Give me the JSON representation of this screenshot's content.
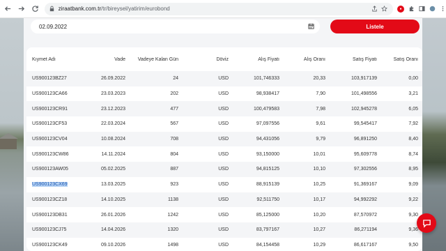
{
  "browser": {
    "url_host": "ziraatbank.com.tr",
    "url_path": "/tr/bireysel/yatirim/eurobond"
  },
  "filter": {
    "date": "02.09.2022",
    "button_label": "Listele"
  },
  "table": {
    "headers": [
      "Kıymet Adı",
      "Vade",
      "Vadeye Kalan Gün",
      "Döviz",
      "Alış Fiyatı",
      "Alış Oranı",
      "Satış Fiyatı",
      "Satış Oranı"
    ],
    "rows": [
      [
        "US900123BZ27",
        "26.09.2022",
        "24",
        "USD",
        "101,746333",
        "20,33",
        "103,917139",
        "0,00"
      ],
      [
        "US900123CA66",
        "23.03.2023",
        "202",
        "USD",
        "98,938417",
        "7,90",
        "101,498556",
        "3,21"
      ],
      [
        "US900123CR91",
        "23.12.2023",
        "477",
        "USD",
        "100,479583",
        "7,98",
        "102,945278",
        "6,05"
      ],
      [
        "US900123CF53",
        "22.03.2024",
        "567",
        "USD",
        "97,097556",
        "9,61",
        "99,545417",
        "7,92"
      ],
      [
        "US900123CV04",
        "10.08.2024",
        "708",
        "USD",
        "94,431056",
        "9,79",
        "96,891250",
        "8,40"
      ],
      [
        "US900123CW86",
        "14.11.2024",
        "804",
        "USD",
        "93,150000",
        "10,01",
        "95,609778",
        "8,74"
      ],
      [
        "US900123AW05",
        "05.02.2025",
        "887",
        "USD",
        "94,815125",
        "10,10",
        "97,302556",
        "8,95"
      ],
      [
        "US900123CX69",
        "13.03.2025",
        "923",
        "USD",
        "88,915139",
        "10,25",
        "91,369167",
        "9,09"
      ],
      [
        "US900123CZ18",
        "14.10.2025",
        "1138",
        "USD",
        "92,511750",
        "10,17",
        "94,992292",
        "9,22"
      ],
      [
        "US900123DB31",
        "26.01.2026",
        "1242",
        "USD",
        "85,125000",
        "10,20",
        "87,570972",
        "9,30"
      ],
      [
        "US900123CJ75",
        "14.04.2026",
        "1320",
        "USD",
        "83,797167",
        "10,27",
        "86,271194",
        "9,36"
      ],
      [
        "US900123CK49",
        "09.10.2026",
        "1498",
        "USD",
        "84,154458",
        "10,29",
        "86,617167",
        "9,50"
      ]
    ]
  },
  "icons": {
    "back": "arrow-left-icon",
    "forward": "arrow-right-icon",
    "reload": "reload-icon",
    "lock": "lock-icon",
    "calendar": "calendar-icon",
    "chat": "chat-icon"
  },
  "colors": {
    "brand_red": "#e30a17",
    "selection": "#b8d4f5"
  }
}
